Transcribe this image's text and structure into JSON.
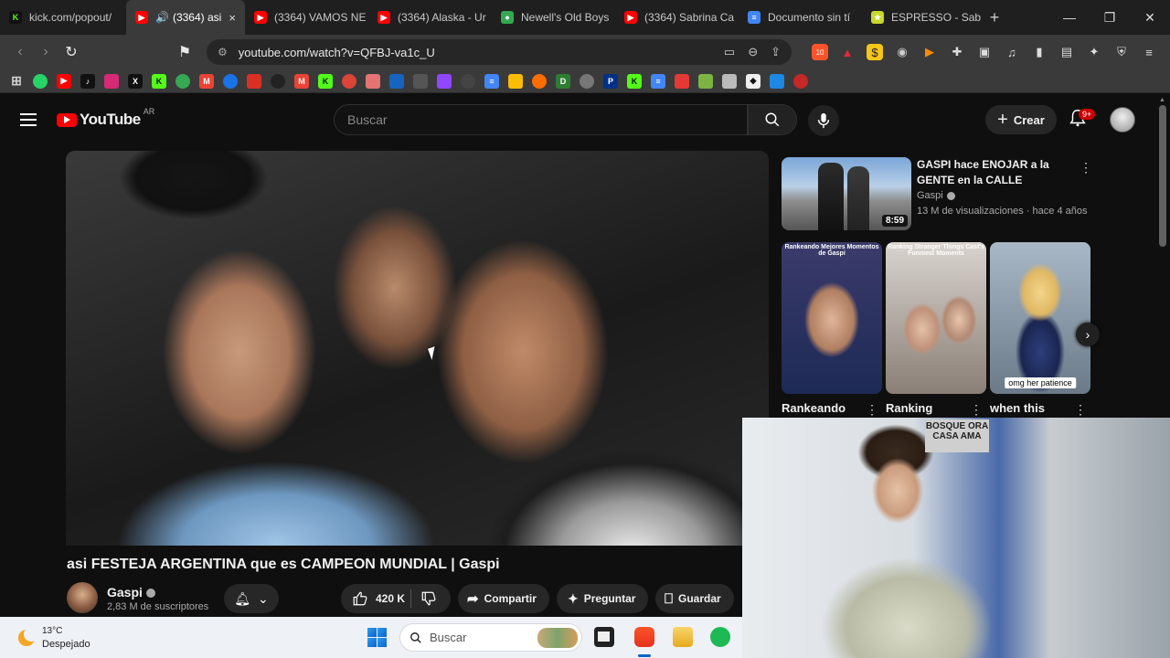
{
  "browser": {
    "tabs": [
      {
        "label": "kick.com/popout/",
        "color": "#53fc18",
        "glyph": "K"
      },
      {
        "label": "(3364) asi",
        "color": "#ff0000",
        "glyph": "▶",
        "active": true
      },
      {
        "label": "(3364) VAMOS NE",
        "color": "#ff0000",
        "glyph": "▶"
      },
      {
        "label": "(3364) Alaska - Ur",
        "color": "#ff0000",
        "glyph": "▶"
      },
      {
        "label": "Newell's Old Boys",
        "color": "#34a853",
        "glyph": "●"
      },
      {
        "label": "(3364) Sabrina Ca",
        "color": "#ff0000",
        "glyph": "▶"
      },
      {
        "label": "Documento sin tí",
        "color": "#4285f4",
        "glyph": "≡"
      },
      {
        "label": "ESPRESSO - Sabri",
        "color": "#c8d82a",
        "glyph": "★"
      }
    ],
    "tab_close": "×",
    "new_tab": "+",
    "url": "youtube.com/watch?v=QFBJ-va1c_U",
    "brave_count": "10"
  },
  "youtube": {
    "logo_text": "YouTube",
    "country": "AR",
    "search_placeholder": "Buscar",
    "create_label": "Crear",
    "notif_badge": "9+"
  },
  "video": {
    "title": "asi FESTEJA ARGENTINA que es CAMPEON MUNDIAL | Gaspi",
    "channel": "Gaspi",
    "subscribers": "2,83 M de suscriptores",
    "likes": "420 K",
    "share_label": "Compartir",
    "ask_label": "Preguntar",
    "save_label": "Guardar"
  },
  "recommended": {
    "title": "GASPI hace ENOJAR a la GENTE en la CALLE",
    "channel": "Gaspi",
    "meta": "13 M de visualizaciones · hace 4 años",
    "duration": "8:59"
  },
  "shorts": [
    {
      "label": "Rankeando",
      "top": "Rankeando Mejores Momentos de Gaspi",
      "tag": ""
    },
    {
      "label": "Ranking",
      "top": "Ranking Stranger Things Cast's Funniest Moments",
      "tag": ""
    },
    {
      "label": "when this",
      "top": "",
      "tag": "omg her patience"
    }
  ],
  "webcam": {
    "poster": "BOSQUE ORA CASA AMA"
  },
  "taskbar": {
    "temperature": "13°C",
    "weather": "Despejado",
    "search_placeholder": "Buscar"
  }
}
